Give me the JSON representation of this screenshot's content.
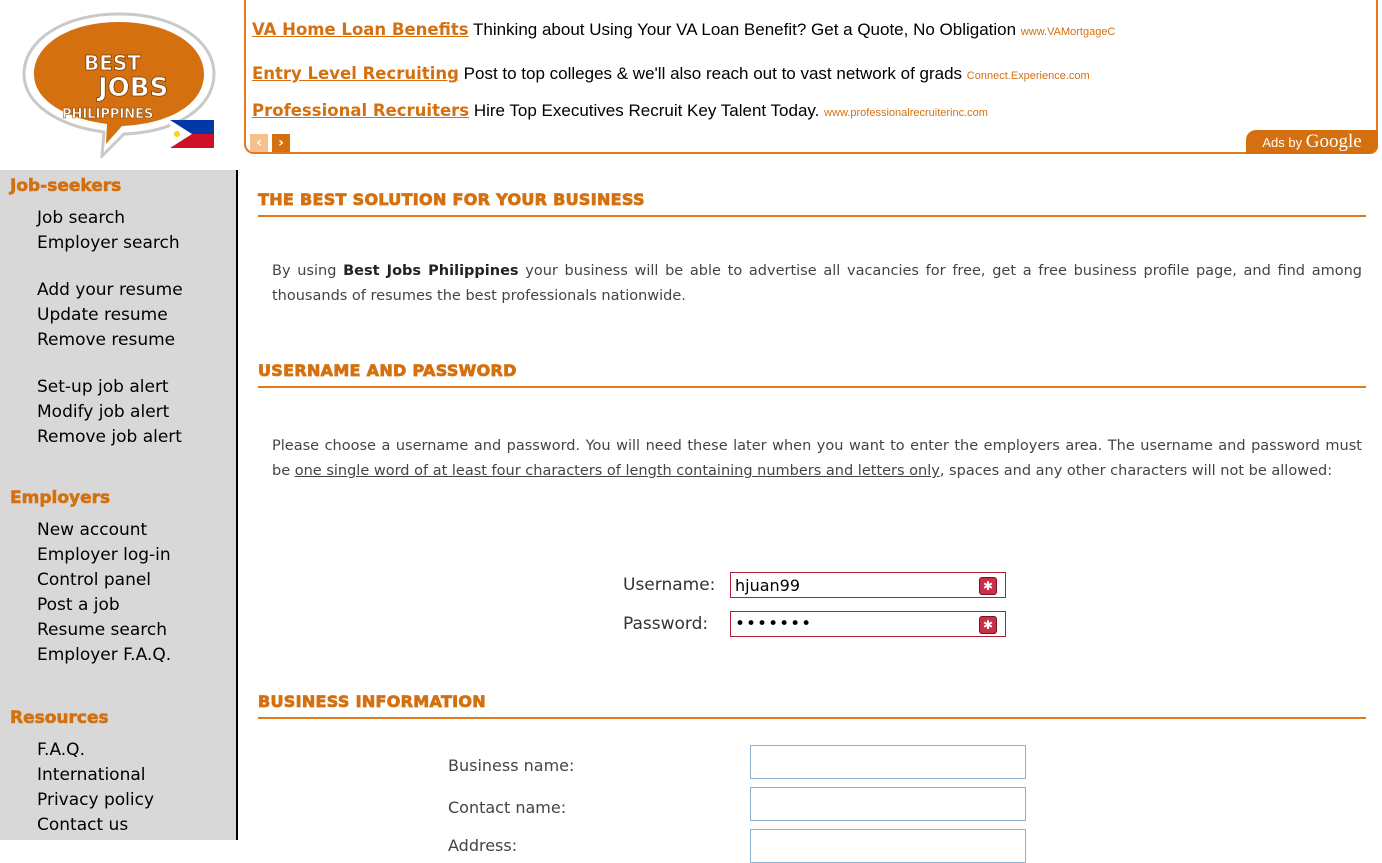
{
  "logo": {
    "line1": "BEST",
    "line2": "JOBS",
    "line3": "PHILIPPINES"
  },
  "ads": {
    "items": [
      {
        "title": "VA Home Loan Benefits",
        "text": "Thinking about Using Your VA Loan Benefit? Get a Quote, No Obligation",
        "url": "www.VAMortgageC"
      },
      {
        "title": "Entry Level Recruiting",
        "text": "Post to top colleges & we'll also reach out to vast network of grads",
        "url": "Connect.Experience.com"
      },
      {
        "title": "Professional Recruiters",
        "text": "Hire Top Executives Recruit Key Talent Today.",
        "url": "www.professionalrecruiterinc.com"
      }
    ],
    "prev": "‹",
    "next": "›",
    "ads_by": "Ads by",
    "google": "Google"
  },
  "sidebar": {
    "jobseekers_head": "Job-seekers",
    "jobseekers": [
      "Job search",
      "Employer search",
      "Add your resume",
      "Update resume",
      "Remove resume",
      "Set-up job alert",
      "Modify job alert",
      "Remove job alert"
    ],
    "employers_head": "Employers",
    "employers": [
      "New account",
      "Employer log-in",
      "Control panel",
      "Post a job",
      "Resume search",
      "Employer F.A.Q."
    ],
    "resources_head": "Resources",
    "resources": [
      "F.A.Q.",
      "International",
      "Privacy policy",
      "Contact us"
    ]
  },
  "main": {
    "section1": "THE BEST SOLUTION FOR YOUR BUSINESS",
    "intro_pre": "By using ",
    "intro_brand": "Best Jobs Philippines",
    "intro_post": " your business will be able to advertise all vacancies for free, get a free business profile page, and find among thousands of resumes the best professionals nationwide.",
    "section2": "USERNAME AND PASSWORD",
    "cred_pre": "Please choose a username and password. You will need these later when you want to enter the employers area. The username and password must be ",
    "cred_rule": "one single word of at least four characters of length containing numbers and letters only",
    "cred_post": ", spaces and any other characters will not be allowed:",
    "username_label": "Username:",
    "username_value": "hjuan99",
    "password_label": "Password:",
    "password_value": "•••••••",
    "section3": "BUSINESS INFORMATION",
    "business_name_label": "Business name:",
    "contact_name_label": "Contact name:",
    "address_label": "Address:"
  },
  "colors": {
    "accent": "#d4700f",
    "sidebar_bg": "#d8d8d8",
    "error": "#c8304a",
    "input_border": "#8fb0cf"
  }
}
